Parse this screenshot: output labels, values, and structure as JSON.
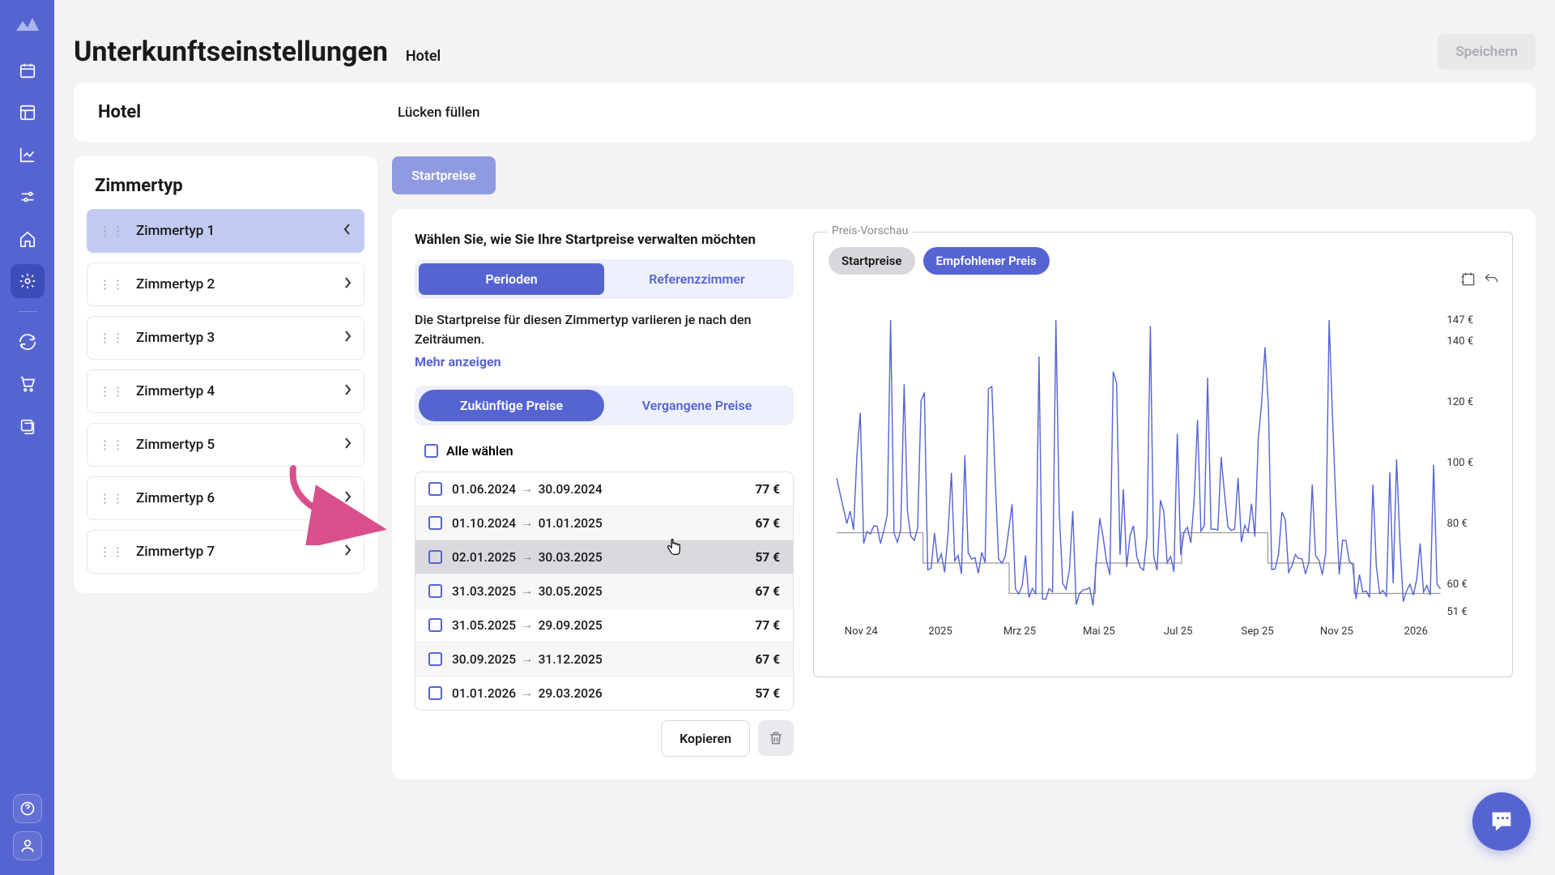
{
  "header": {
    "title": "Unterkunftseinstellungen",
    "breadcrumb": "Hotel",
    "save_label": "Speichern"
  },
  "hotel_section": {
    "label": "Hotel",
    "fill_gaps": "Lücken füllen"
  },
  "room_types": {
    "title": "Zimmertyp",
    "items": [
      {
        "label": "Zimmertyp 1",
        "selected": true
      },
      {
        "label": "Zimmertyp 2",
        "selected": false
      },
      {
        "label": "Zimmertyp 3",
        "selected": false
      },
      {
        "label": "Zimmertyp 4",
        "selected": false
      },
      {
        "label": "Zimmertyp 5",
        "selected": false
      },
      {
        "label": "Zimmertyp 6",
        "selected": false
      },
      {
        "label": "Zimmertyp 7",
        "selected": false
      }
    ]
  },
  "pricing": {
    "startpreise_label": "Startpreise",
    "manage_title": "Wählen Sie, wie Sie Ihre Startpreise verwalten möchten",
    "mode_options": {
      "perioden": "Perioden",
      "referenz": "Referenzzimmer"
    },
    "description": "Die Startpreise für diesen Zimmertyp variieren je nach den Zeiträumen.",
    "show_more": "Mehr anzeigen",
    "price_tabs": {
      "future": "Zukünftige Preise",
      "past": "Vergangene Preise"
    },
    "select_all": "Alle wählen",
    "periods": [
      {
        "from": "01.06.2024",
        "to": "30.09.2024",
        "price": "77 €",
        "highlighted": false
      },
      {
        "from": "01.10.2024",
        "to": "01.01.2025",
        "price": "67 €",
        "highlighted": false
      },
      {
        "from": "02.01.2025",
        "to": "30.03.2025",
        "price": "57 €",
        "highlighted": true
      },
      {
        "from": "31.03.2025",
        "to": "30.05.2025",
        "price": "67 €",
        "highlighted": false
      },
      {
        "from": "31.05.2025",
        "to": "29.09.2025",
        "price": "77 €",
        "highlighted": false
      },
      {
        "from": "30.09.2025",
        "to": "31.12.2025",
        "price": "67 €",
        "highlighted": false
      },
      {
        "from": "01.01.2026",
        "to": "29.03.2026",
        "price": "57 €",
        "highlighted": false
      }
    ],
    "copy_label": "Kopieren"
  },
  "chart": {
    "legend_label": "Preis-Vorschau",
    "toggles": {
      "start": "Startpreise",
      "recommended": "Empfohlener Preis"
    }
  },
  "chart_data": {
    "type": "line",
    "title": "Preis-Vorschau",
    "ylabel": "€",
    "ylim": [
      51,
      147
    ],
    "yticks": [
      147,
      140,
      120,
      100,
      80,
      60,
      51
    ],
    "ytick_labels": [
      "147 €",
      "140 €",
      "120 €",
      "100 €",
      "80 €",
      "60 €",
      "51 €"
    ],
    "xticks": [
      "Nov 24",
      "2025",
      "Mrz 25",
      "Mai 25",
      "Jul 25",
      "Sep 25",
      "Nov 25",
      "2026"
    ],
    "series": [
      {
        "name": "Startpreise",
        "color": "#888",
        "values_by_period": [
          {
            "from": "2024-06-01",
            "to": "2024-09-30",
            "y": 77
          },
          {
            "from": "2024-10-01",
            "to": "2025-01-01",
            "y": 67
          },
          {
            "from": "2025-01-02",
            "to": "2025-03-30",
            "y": 57
          },
          {
            "from": "2025-03-31",
            "to": "2025-05-30",
            "y": 67
          },
          {
            "from": "2025-05-31",
            "to": "2025-09-29",
            "y": 77
          },
          {
            "from": "2025-09-30",
            "to": "2025-12-31",
            "y": 67
          },
          {
            "from": "2026-01-01",
            "to": "2026-03-29",
            "y": 57
          }
        ]
      },
      {
        "name": "Empfohlener Preis",
        "color": "#5664D2",
        "note": "Daily volatile values between ~51 and ~147; chart depicts spiky line with baseline tracking Startpreise steps."
      }
    ]
  }
}
